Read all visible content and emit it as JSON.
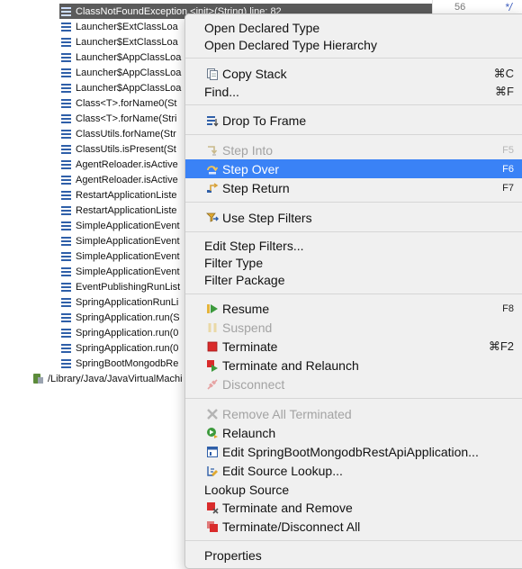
{
  "tree": {
    "rows": [
      "ClassNotFoundException.<init>(String) line: 82",
      "Launcher$ExtClassLoa",
      "Launcher$ExtClassLoa",
      "Launcher$AppClassLoa",
      "Launcher$AppClassLoa",
      "Launcher$AppClassLoa",
      "Class<T>.forName0(St",
      "Class<T>.forName(Stri",
      "ClassUtils.forName(Str",
      "ClassUtils.isPresent(St",
      "AgentReloader.isActive",
      "AgentReloader.isActive",
      "RestartApplicationListe",
      "RestartApplicationListe",
      "SimpleApplicationEvent",
      "SimpleApplicationEvent",
      "SimpleApplicationEvent",
      "SimpleApplicationEvent",
      "EventPublishingRunList",
      "SpringApplicationRunLi",
      "SpringApplication.run(S",
      "SpringApplication.run(0",
      "SpringApplication.run(0",
      "SpringBootMongodbRe"
    ],
    "vm_row": "/Library/Java/JavaVirtualMachi"
  },
  "editor": {
    "line_number": "56",
    "text": "*/"
  },
  "menu": {
    "items": [
      {
        "label": "Open Declared Type"
      },
      {
        "label": "Open Declared Type Hierarchy"
      },
      {
        "label": "Copy Stack",
        "shortcut": "⌘C",
        "icon": "copy-icon"
      },
      {
        "label": "Find...",
        "shortcut": "⌘F"
      },
      {
        "label": "Drop To Frame",
        "icon": "drop-to-frame-icon"
      },
      {
        "label": "Step Into",
        "shortcut": "F5",
        "icon": "step-into-icon",
        "disabled": true
      },
      {
        "label": "Step Over",
        "shortcut": "F6",
        "icon": "step-over-icon",
        "highlighted": true
      },
      {
        "label": "Step Return",
        "shortcut": "F7",
        "icon": "step-return-icon"
      },
      {
        "label": "Use Step Filters",
        "icon": "step-filters-icon"
      },
      {
        "label": "Edit Step Filters..."
      },
      {
        "label": "Filter Type"
      },
      {
        "label": "Filter Package"
      },
      {
        "label": "Resume",
        "shortcut": "F8",
        "icon": "resume-icon"
      },
      {
        "label": "Suspend",
        "icon": "suspend-icon",
        "disabled": true
      },
      {
        "label": "Terminate",
        "shortcut": "⌘F2",
        "icon": "terminate-icon"
      },
      {
        "label": "Terminate and Relaunch",
        "icon": "terminate-relaunch-icon"
      },
      {
        "label": "Disconnect",
        "icon": "disconnect-icon",
        "disabled": true
      },
      {
        "label": "Remove All Terminated",
        "icon": "remove-all-terminated-icon",
        "disabled": true
      },
      {
        "label": "Relaunch",
        "icon": "relaunch-icon"
      },
      {
        "label": "Edit SpringBootMongodbRestApiApplication...",
        "icon": "edit-config-icon"
      },
      {
        "label": "Edit Source Lookup...",
        "icon": "source-lookup-icon"
      },
      {
        "label": "Lookup Source"
      },
      {
        "label": "Terminate and Remove",
        "icon": "terminate-remove-icon"
      },
      {
        "label": "Terminate/Disconnect All",
        "icon": "terminate-all-icon"
      },
      {
        "label": "Properties"
      }
    ]
  },
  "colors": {
    "highlight": "#3a82f6",
    "selected_row": "#5b5b5b",
    "terminate_red": "#d92b2b"
  }
}
